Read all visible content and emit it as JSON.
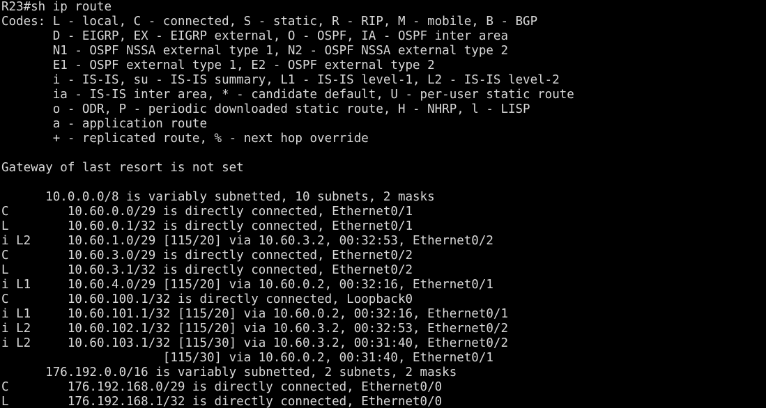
{
  "terminal": {
    "text_color": "#d8d8d8",
    "background_color": "#000000",
    "lines": [
      "R23#sh ip route",
      "Codes: L - local, C - connected, S - static, R - RIP, M - mobile, B - BGP",
      "       D - EIGRP, EX - EIGRP external, O - OSPF, IA - OSPF inter area",
      "       N1 - OSPF NSSA external type 1, N2 - OSPF NSSA external type 2",
      "       E1 - OSPF external type 1, E2 - OSPF external type 2",
      "       i - IS-IS, su - IS-IS summary, L1 - IS-IS level-1, L2 - IS-IS level-2",
      "       ia - IS-IS inter area, * - candidate default, U - per-user static route",
      "       o - ODR, P - periodic downloaded static route, H - NHRP, l - LISP",
      "       a - application route",
      "       + - replicated route, % - next hop override",
      "",
      "Gateway of last resort is not set",
      "",
      "      10.0.0.0/8 is variably subnetted, 10 subnets, 2 masks",
      "C        10.60.0.0/29 is directly connected, Ethernet0/1",
      "L        10.60.0.1/32 is directly connected, Ethernet0/1",
      "i L2     10.60.1.0/29 [115/20] via 10.60.3.2, 00:32:53, Ethernet0/2",
      "C        10.60.3.0/29 is directly connected, Ethernet0/2",
      "L        10.60.3.1/32 is directly connected, Ethernet0/2",
      "i L1     10.60.4.0/29 [115/20] via 10.60.0.2, 00:32:16, Ethernet0/1",
      "C        10.60.100.1/32 is directly connected, Loopback0",
      "i L1     10.60.101.1/32 [115/20] via 10.60.0.2, 00:32:16, Ethernet0/1",
      "i L2     10.60.102.1/32 [115/20] via 10.60.3.2, 00:32:53, Ethernet0/2",
      "i L2     10.60.103.1/32 [115/30] via 10.60.3.2, 00:31:40, Ethernet0/2",
      "                      [115/30] via 10.60.0.2, 00:31:40, Ethernet0/1",
      "      176.192.0.0/16 is variably subnetted, 2 subnets, 2 masks",
      "C        176.192.168.0/29 is directly connected, Ethernet0/0",
      "L        176.192.168.1/32 is directly connected, Ethernet0/0"
    ]
  }
}
